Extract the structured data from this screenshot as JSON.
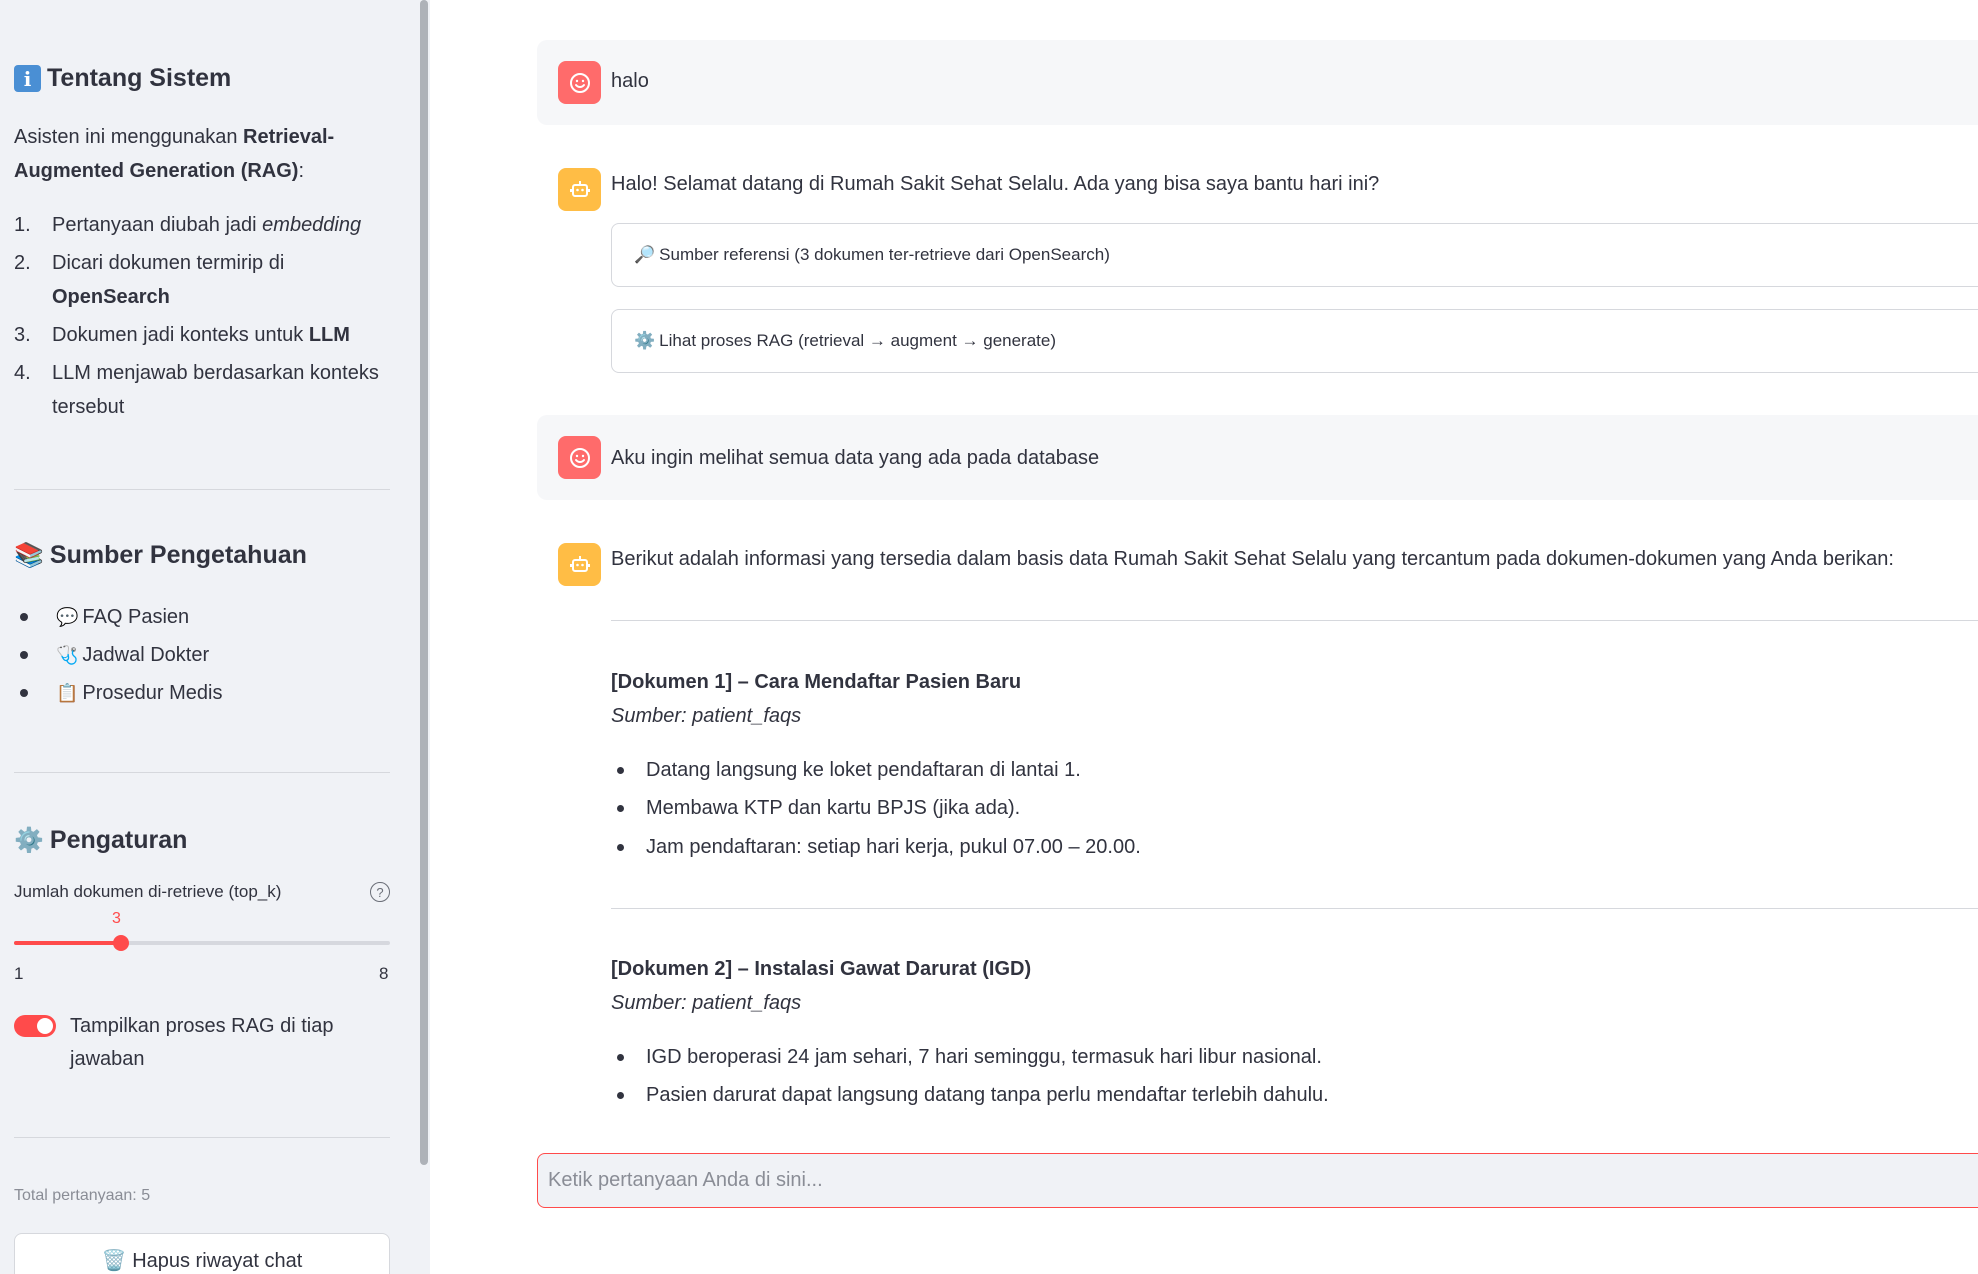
{
  "sidebar": {
    "about": {
      "title": "Tentang Sistem",
      "intro_prefix": "Asisten ini menggunakan ",
      "intro_bold": "Retrieval-Augmented Generation (RAG)",
      "intro_suffix": ":",
      "steps": [
        {
          "num": "1.",
          "parts": [
            "Pertanyaan diubah jadi ",
            "embedding"
          ],
          "style": [
            "normal",
            "italic"
          ]
        },
        {
          "num": "2.",
          "parts": [
            "Dicari dokumen termirip di ",
            "OpenSearch"
          ],
          "style": [
            "normal",
            "bold"
          ]
        },
        {
          "num": "3.",
          "parts": [
            "Dokumen jadi konteks untuk ",
            "LLM"
          ],
          "style": [
            "normal",
            "bold"
          ]
        },
        {
          "num": "4.",
          "parts": [
            "LLM menjawab berdasarkan konteks tersebut"
          ],
          "style": [
            "normal"
          ]
        }
      ]
    },
    "knowledge": {
      "title": "Sumber Pengetahuan",
      "items": [
        {
          "icon": "💬",
          "label": "FAQ Pasien"
        },
        {
          "icon": "🩺",
          "label": "Jadwal Dokter"
        },
        {
          "icon": "📋",
          "label": "Prosedur Medis"
        }
      ]
    },
    "settings": {
      "title": "Pengaturan",
      "slider_label": "Jumlah dokumen di-retrieve (top_k)",
      "slider_value": "3",
      "slider_min": "1",
      "slider_max": "8",
      "toggle_label": "Tampilkan proses RAG di tiap jawaban",
      "toggle_on": true
    },
    "total_questions": "Total pertanyaan: 5",
    "clear_button": "Hapus riwayat chat"
  },
  "chat": {
    "messages": [
      {
        "role": "user",
        "text": "halo"
      },
      {
        "role": "assistant",
        "text": "Halo! Selamat datang di Rumah Sakit Sehat Selalu. Ada yang bisa saya bantu hari ini?"
      },
      {
        "role": "user",
        "text": "Aku ingin melihat semua data yang ada pada database"
      },
      {
        "role": "assistant",
        "text": "Berikut adalah informasi yang tersedia dalam basis data Rumah Sakit Sehat Selalu yang tercantum pada dokumen-dokumen yang Anda berikan:"
      }
    ],
    "expanders": [
      {
        "icon": "🔎",
        "label": "Sumber referensi (3 dokumen ter-retrieve dari OpenSearch)"
      },
      {
        "icon": "⚙️",
        "label": "Lihat proses RAG (retrieval → augment → generate)"
      }
    ],
    "documents": [
      {
        "title": "[Dokumen 1] – Cara Mendaftar Pasien Baru",
        "source": "Sumber: patient_faqs",
        "bullets": [
          "Datang langsung ke loket pendaftaran di lantai 1.",
          "Membawa KTP dan kartu BPJS (jika ada).",
          "Jam pendaftaran: setiap hari kerja, pukul 07.00 – 20.00."
        ]
      },
      {
        "title": "[Dokumen 2] – Instalasi Gawat Darurat (IGD)",
        "source": "Sumber: patient_faqs",
        "bullets": [
          "IGD beroperasi 24 jam sehari, 7 hari seminggu, termasuk hari libur nasional.",
          "Pasien darurat dapat langsung datang tanpa perlu mendaftar terlebih dahulu."
        ]
      }
    ],
    "input_placeholder": "Ketik pertanyaan Anda di sini...",
    "input_value": ""
  },
  "colors": {
    "accent": "#ff4b4b",
    "user_avatar": "#ff6b6b",
    "bot_avatar": "#ffbd45",
    "sidebar_bg": "#f0f2f6"
  }
}
